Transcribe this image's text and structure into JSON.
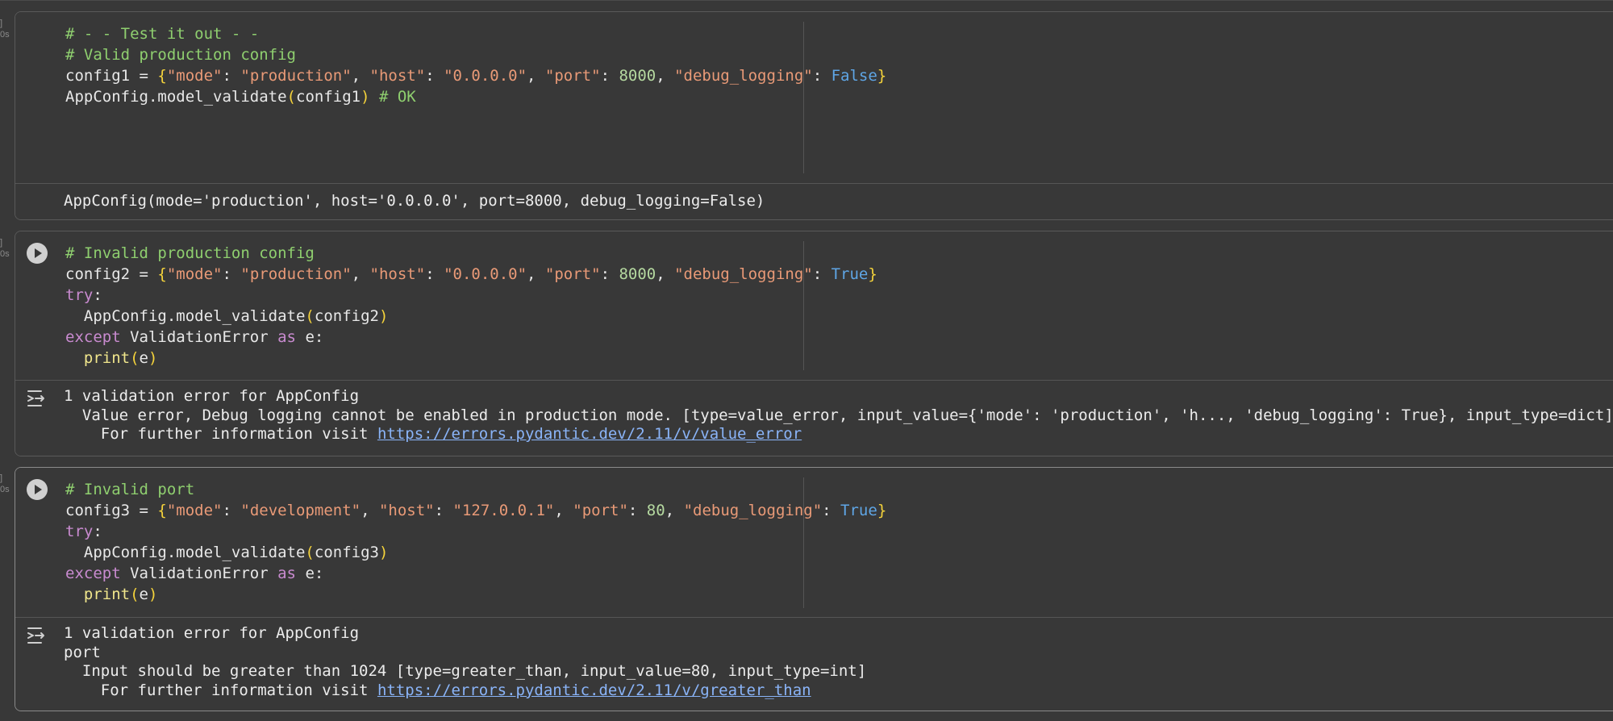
{
  "gutter": {
    "bracket": "]",
    "duration": "0s"
  },
  "cells": [
    {
      "lines": [
        "# - - Test it out - -",
        "# Valid production config",
        "config1 = {\"mode\": \"production\", \"host\": \"0.0.0.0\", \"port\": 8000, \"debug_logging\": False}",
        "AppConfig.model_validate(config1) # OK"
      ],
      "output": [
        "AppConfig(mode='production', host='0.0.0.0', port=8000, debug_logging=False)"
      ]
    },
    {
      "lines": [
        "# Invalid production config",
        "config2 = {\"mode\": \"production\", \"host\": \"0.0.0.0\", \"port\": 8000, \"debug_logging\": True}",
        "try:",
        "  AppConfig.model_validate(config2)",
        "except ValidationError as e:",
        "  print(e)"
      ],
      "output": [
        "1 validation error for AppConfig",
        "  Value error, Debug logging cannot be enabled in production mode. [type=value_error, input_value={'mode': 'production', 'h..., 'debug_logging': True}, input_type=dict]",
        "    For further information visit "
      ],
      "output_link": "https://errors.pydantic.dev/2.11/v/value_error"
    },
    {
      "lines": [
        "# Invalid port",
        "config3 = {\"mode\": \"development\", \"host\": \"127.0.0.1\", \"port\": 80, \"debug_logging\": True}",
        "try:",
        "  AppConfig.model_validate(config3)",
        "except ValidationError as e:",
        "  print(e)"
      ],
      "output": [
        "1 validation error for AppConfig",
        "port",
        "  Input should be greater than 1024 [type=greater_than, input_value=80, input_type=int]",
        "    For further information visit "
      ],
      "output_link": "https://errors.pydantic.dev/2.11/v/greater_than"
    }
  ],
  "colors": {
    "background": "#383838",
    "comment": "#8fcf6f",
    "string": "#e99a77",
    "number": "#b5d9a0",
    "keyword": "#c98bd0",
    "boolean": "#5fa6e6",
    "bracket": "#f5d33b",
    "link": "#8ab4f8"
  },
  "icons": {
    "run": "play-circle-icon",
    "output_toggle": "output-menu-icon"
  }
}
